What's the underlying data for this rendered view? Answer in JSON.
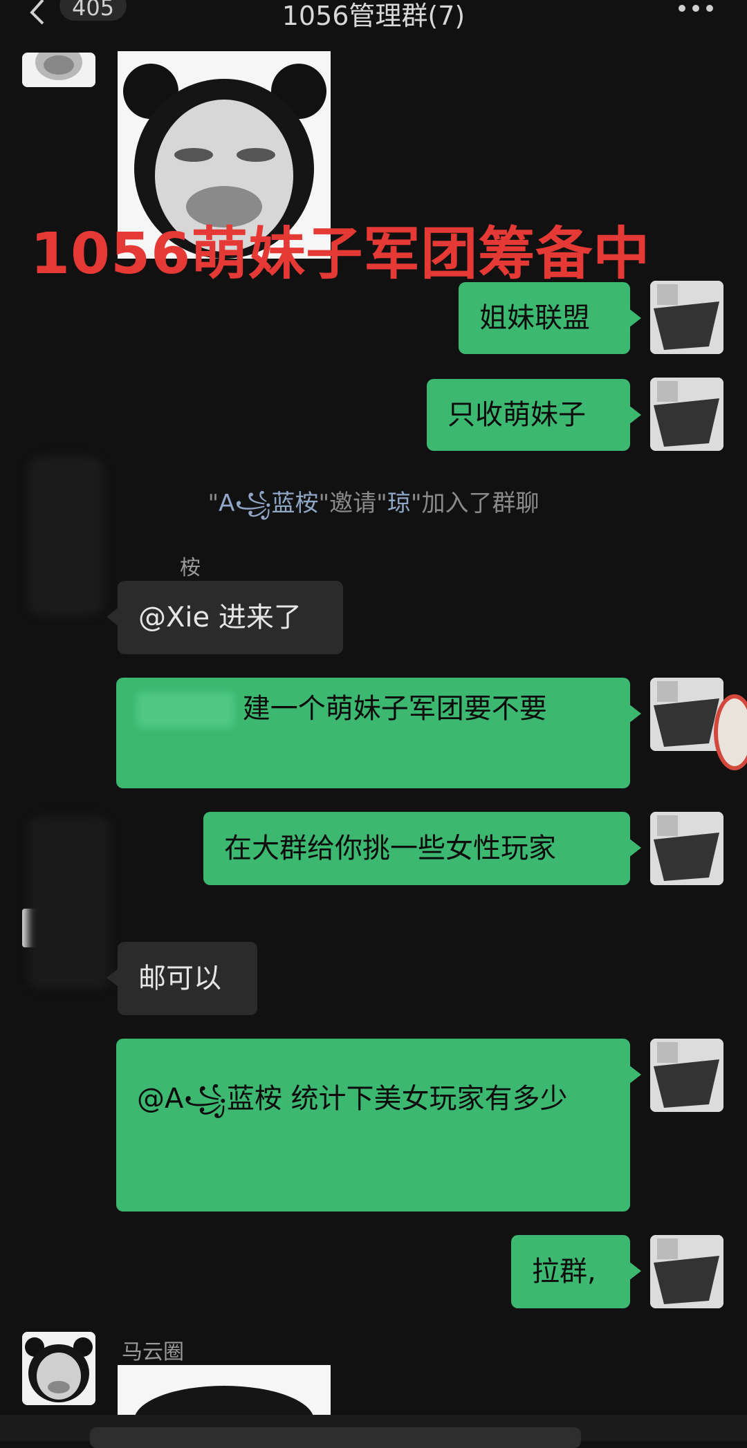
{
  "header": {
    "unread_count": "405",
    "title": "1056管理群(7)"
  },
  "overlay_caption": "1056萌妹子军团筹备中",
  "messages": [
    {
      "text": "姐妹联盟"
    },
    {
      "text": "只收萌妹子"
    },
    {
      "text": "建一个萌妹子军团要不要"
    },
    {
      "text": "在大群给你挑一些女性玩家"
    },
    {
      "text": "@A꧁蓝桉 统计下美女玩家有多少"
    },
    {
      "text": "拉群,"
    }
  ],
  "system_notice": {
    "q1": "\"",
    "inviter": "A꧁蓝桉",
    "q2": "\"邀请\"",
    "invitee": "琼",
    "q3": "\"加入了群聊"
  },
  "incoming": [
    {
      "sender": "桉",
      "text": "@Xie  进来了"
    },
    {
      "sender": "",
      "text": "邮可以"
    },
    {
      "sender": "马云圈",
      "text": ""
    }
  ],
  "partial_name": "琼"
}
